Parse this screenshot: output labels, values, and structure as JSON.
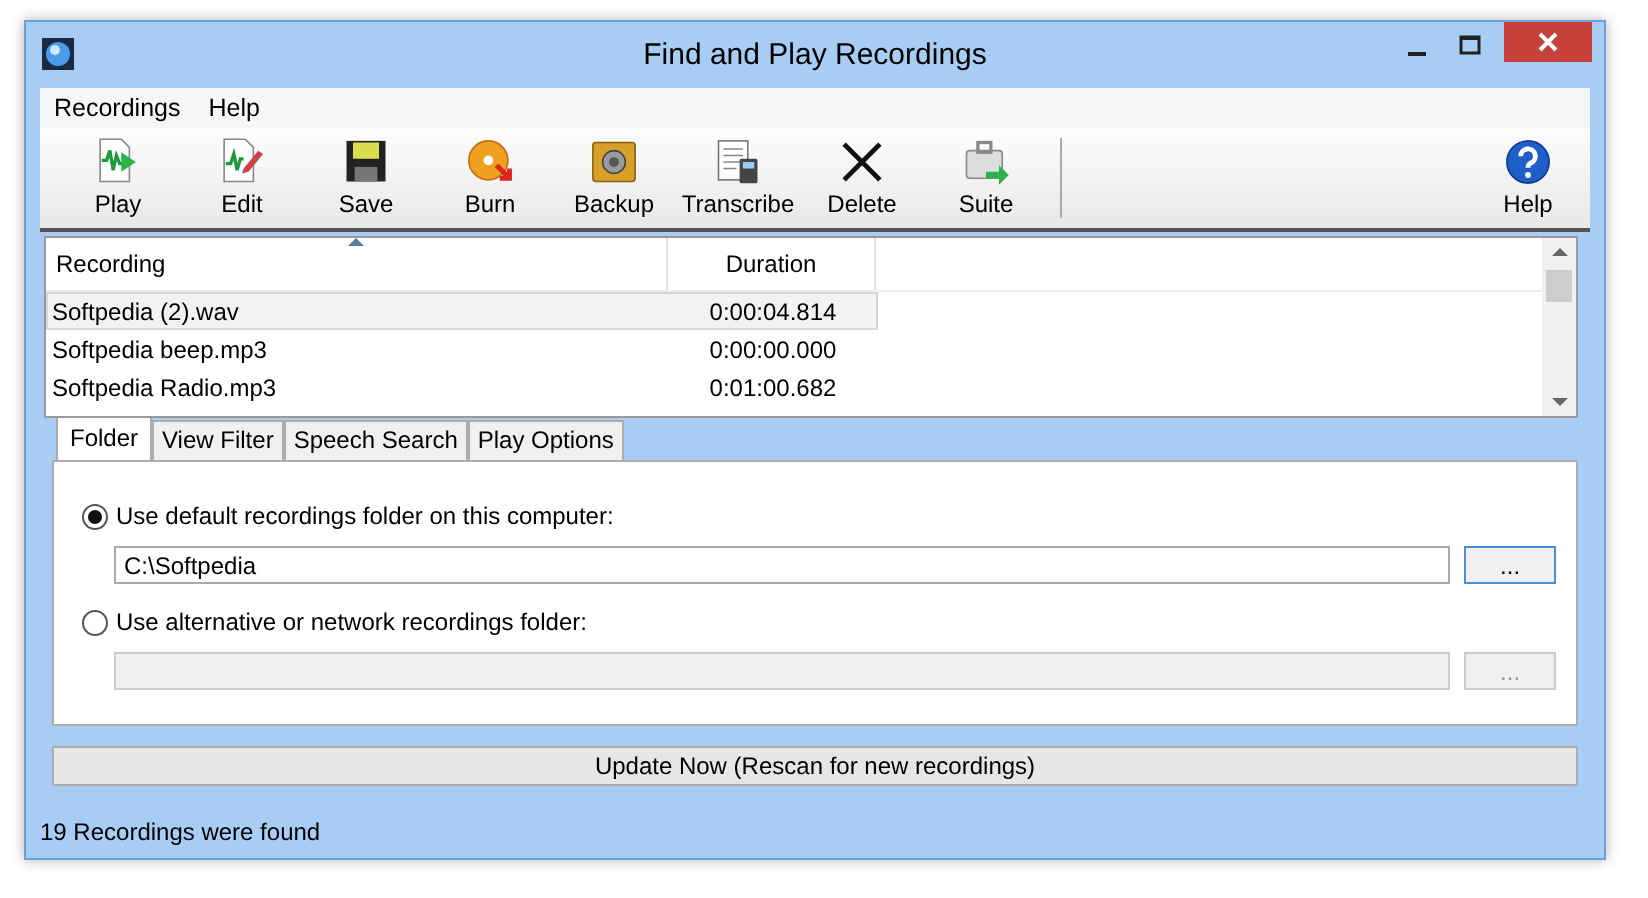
{
  "window": {
    "title": "Find and Play Recordings"
  },
  "menu": [
    "Recordings",
    "Help"
  ],
  "toolbar": [
    {
      "kind": "play",
      "label": "Play"
    },
    {
      "kind": "edit",
      "label": "Edit"
    },
    {
      "kind": "save",
      "label": "Save"
    },
    {
      "kind": "burn",
      "label": "Burn"
    },
    {
      "kind": "backup",
      "label": "Backup"
    },
    {
      "kind": "transcribe",
      "label": "Transcribe"
    },
    {
      "kind": "delete",
      "label": "Delete"
    },
    {
      "kind": "suite",
      "label": "Suite"
    },
    {
      "kind": "help",
      "label": "Help"
    }
  ],
  "table": {
    "columns": [
      "Recording",
      "Duration"
    ],
    "rows": [
      {
        "name": "Softpedia (2).wav",
        "duration": "0:00:04.814",
        "selected": true
      },
      {
        "name": "Softpedia beep.mp3",
        "duration": "0:00:00.000",
        "selected": false
      },
      {
        "name": "Softpedia Radio.mp3",
        "duration": "0:01:00.682",
        "selected": false
      }
    ]
  },
  "tabs": [
    {
      "label": "Folder",
      "selected": true
    },
    {
      "label": "View Filter",
      "selected": false
    },
    {
      "label": "Speech Search",
      "selected": false
    },
    {
      "label": "Play Options",
      "selected": false
    }
  ],
  "folder_options": [
    {
      "label": "Use default recordings folder on this computer:",
      "selected": true,
      "value": "C:\\Softpedia",
      "disabled": false,
      "browse": "..."
    },
    {
      "label": "Use alternative or network recordings folder:",
      "selected": false,
      "disabled": true,
      "browse": "..."
    }
  ],
  "update_button": "Update Now (Rescan for new recordings)",
  "status_bar": "19 Recordings were found"
}
